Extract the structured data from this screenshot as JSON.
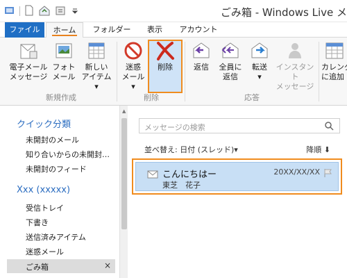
{
  "window": {
    "title": "ごみ箱 - Windows Live メ"
  },
  "tabs": [
    {
      "label": "ファイル"
    },
    {
      "label": "ホーム"
    },
    {
      "label": "フォルダー"
    },
    {
      "label": "表示"
    },
    {
      "label": "アカウント"
    }
  ],
  "ribbon": {
    "new_email": [
      "電子メール",
      "メッセージ"
    ],
    "photo_email": [
      "フォト",
      "メール"
    ],
    "new_item": [
      "新しい",
      "アイテム ▾"
    ],
    "junk": [
      "迷惑",
      "メール ▾"
    ],
    "delete": "削除",
    "reply": "返信",
    "reply_all": [
      "全員に",
      "返信"
    ],
    "forward": [
      "転送",
      "▾"
    ],
    "instant_message": [
      "インスタント",
      "メッセージ"
    ],
    "calendar": [
      "カレンダ",
      "に追加"
    ],
    "groups": {
      "new": "新規作成",
      "delete": "削除",
      "respond": "応答"
    }
  },
  "nav": {
    "quick_views_header": "クイック分類",
    "quick_views": [
      "未開封のメール",
      "知り合いからの未開封…",
      "未開封のフィード"
    ],
    "account_header": "Xxx (xxxxx)",
    "folders": [
      "受信トレイ",
      "下書き",
      "送信済みアイテム",
      "迷惑メール"
    ],
    "selected_folder": "ごみ箱",
    "close_glyph": "×"
  },
  "messages": {
    "search_placeholder": "メッセージの検索",
    "sort_label": "並べ替え: 日付 (スレッド)▾",
    "order_label": "降順 ⬇",
    "items": [
      {
        "subject": "こんにちはー",
        "from": "東芝　花子",
        "date": "20XX/XX/XX"
      }
    ]
  },
  "colors": {
    "accent": "#1f6fc5",
    "highlight": "#f08c1e",
    "selected": "#c8dff5"
  }
}
